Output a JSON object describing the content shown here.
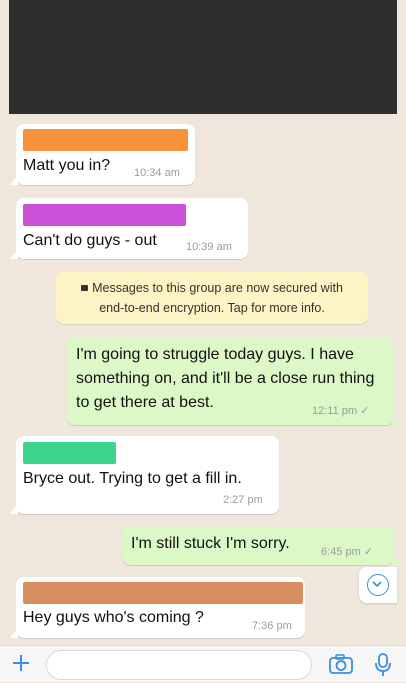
{
  "colors": {
    "incoming_bubble": "#ffffff",
    "outgoing_bubble": "#dcf8c6",
    "system_bubble": "#fdf4c5",
    "accent": "#3a8de0",
    "redaction_orange": "#f7923b",
    "redaction_purple": "#cc4fd8",
    "redaction_green": "#3ed48f",
    "redaction_tan": "#d88e5f",
    "header_redaction": "#2e2e2e"
  },
  "messages": [
    {
      "text": "Matt you in?",
      "time": "10:34 am"
    },
    {
      "text": "Can't do guys - out",
      "time": "10:39 am"
    },
    {
      "text": "I'm going to struggle today guys. I have something on, and it'll be a close run thing to get there at best.",
      "time": "12:11 pm"
    },
    {
      "text": "Bryce out. Trying to get a fill in.",
      "time": "2:27 pm"
    },
    {
      "text": "I'm still stuck I'm sorry.",
      "time": "6:45 pm"
    },
    {
      "text": "Hey guys who's coming ?",
      "time": "7:36 pm"
    }
  ],
  "system_message": {
    "line1": "Messages to this group are now secured with",
    "line2": "end-to-end encryption. Tap for more info."
  },
  "icons": {
    "lock": "lock-icon",
    "add": "plus-icon",
    "camera": "camera-icon",
    "mic": "microphone-icon",
    "scroll": "chevron-down-icon",
    "read": "check-icon"
  }
}
